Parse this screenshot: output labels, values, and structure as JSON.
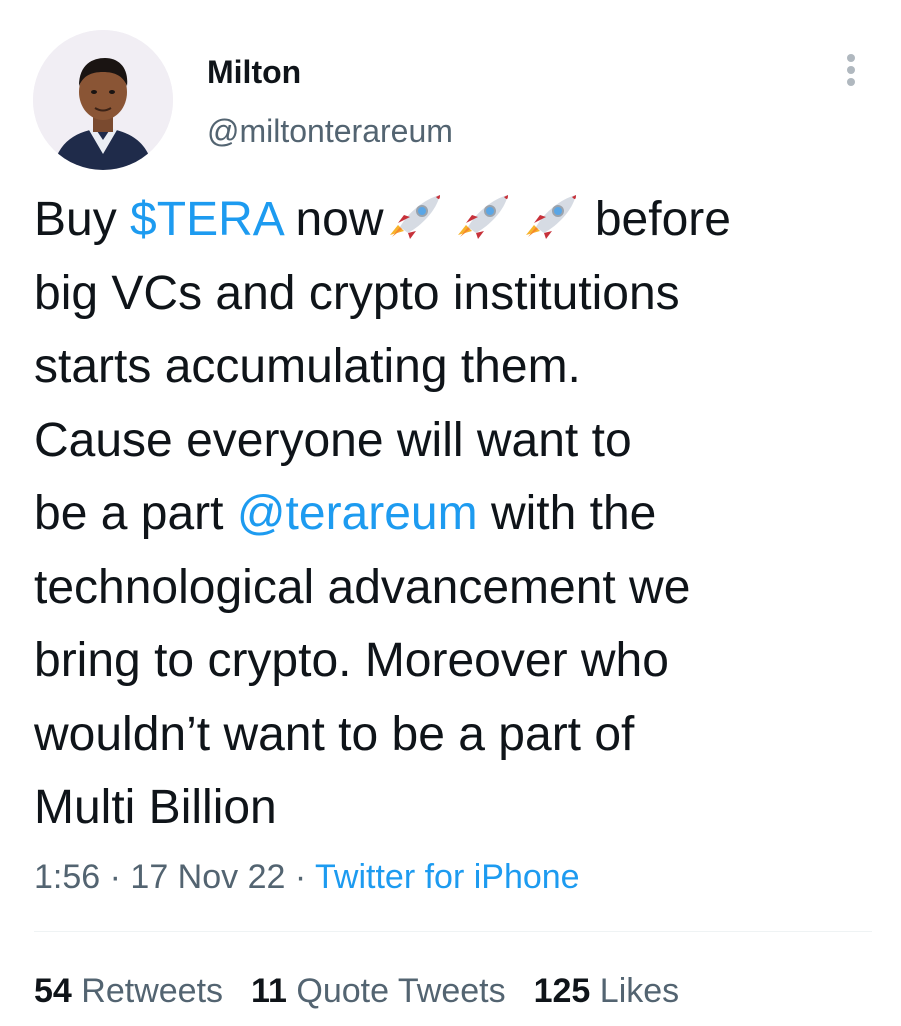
{
  "tweet": {
    "author": {
      "name": "Milton",
      "handle": "@miltonterareum",
      "avatar_icon": "profile-photo"
    },
    "more_icon": "more-vertical-icon",
    "body": {
      "l1_a": "Buy ",
      "l1_cashtag": "$TERA",
      "l1_b": " now",
      "l1_c": " before",
      "rocket_icon": "rocket-emoji",
      "l2": "big VCs and crypto institutions",
      "l3": "starts accumulating them.",
      "l4": "Cause everyone will want to",
      "l5_a": "be a part ",
      "l5_mention": "@terareum",
      "l5_b": " with the",
      "l6": "technological advancement we",
      "l7": "bring to crypto. Moreover who",
      "l8": "wouldn’t want to be a part of",
      "l9": "Multi Billion"
    },
    "meta": {
      "time": "1:56",
      "sep1": " · ",
      "date": "17 Nov 22",
      "sep2": " · ",
      "source": "Twitter for iPhone"
    },
    "stats": {
      "retweets_count": "54",
      "retweets_label": "Retweets",
      "quotes_count": "11",
      "quotes_label": "Quote Tweets",
      "likes_count": "125",
      "likes_label": "Likes"
    },
    "colors": {
      "link": "#1d9bf0",
      "text": "#0f1419",
      "muted": "#536471",
      "divider": "#eff3f4"
    }
  }
}
